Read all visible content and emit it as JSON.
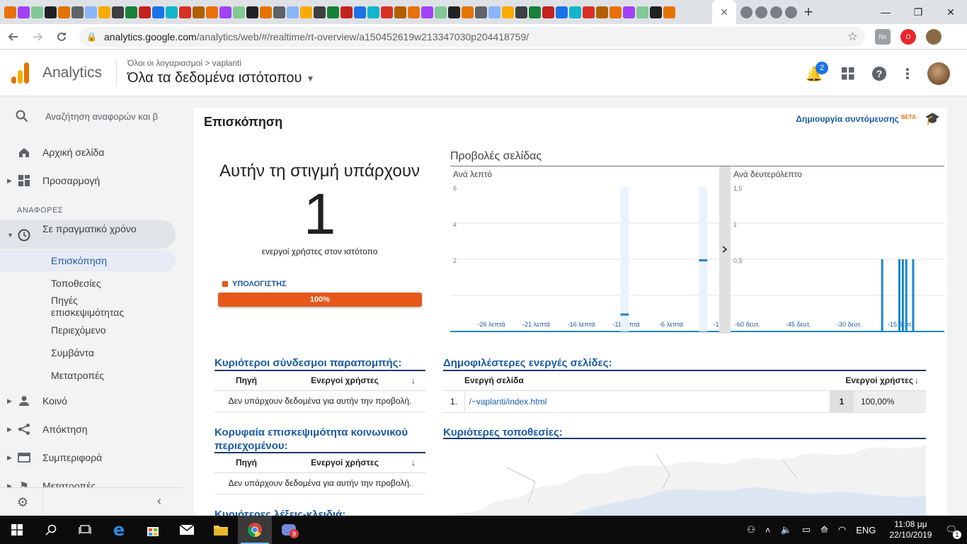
{
  "browser": {
    "url_host": "analytics.google.com",
    "url_path": "/analytics/web/#/realtime/rt-overview/a150452619w213347030p204418759/",
    "tab_close": "✕",
    "new_tab": "+",
    "win_minimize": "—",
    "win_maximize": "❐",
    "win_close": "✕",
    "ext_nx": "Nx"
  },
  "header": {
    "product": "Analytics",
    "breadcrumb": "Όλοι οι λογαριασμοί > vaplanti",
    "view": "Όλα τα δεδομένα ιστότοπου",
    "notifications": "2"
  },
  "sidebar": {
    "search_placeholder": "Αναζήτηση αναφορών και β",
    "home": "Αρχική σελίδα",
    "customization": "Προσαρμογή",
    "reports_header": "ΑΝΑΦΟΡΕΣ",
    "realtime": "Σε πραγματικό χρόνο",
    "realtime_items": [
      "Επισκόπηση",
      "Τοποθεσίες",
      "Πηγές επισκεψιμότητας",
      "Περιεχόμενο",
      "Συμβάντα",
      "Μετατροπές"
    ],
    "audience": "Κοινό",
    "acquisition": "Απόκτηση",
    "behavior": "Συμπεριφορά",
    "conversions_partial": "Μετατροπές"
  },
  "main": {
    "title": "Επισκόπηση",
    "shortcut": "Δημιουργία συντόμευσης",
    "beta": "BETA",
    "now_heading": "Αυτήν τη στιγμή υπάρχουν",
    "active_users": "1",
    "active_users_sub": "ενεργοί χρήστες στον ιστότοπο",
    "device_label": "ΥΠΟΛΟΓΙΣΤΗΣ",
    "device_percent": "100%",
    "device_share": 1.0,
    "pageviews_title": "Προβολές σελίδας",
    "per_minute": "Ανά λεπτό",
    "per_second": "Ανά δευτερόλεπτο",
    "referrals_title": "Κυριότεροι σύνδεσμοι παραπομπής:",
    "social_title": "Κορυφαία επισκεψιμότητα κοινωνικού περιεχομένου:",
    "keywords_title": "Κυριότερες λέξεις-κλειδιά:",
    "col_source": "Πηγή",
    "col_active_users": "Ενεργοί χρήστες",
    "no_data": "Δεν υπάρχουν δεδομένα για αυτήν την προβολή.",
    "pages_title": "Δημοφιλέστερες ενεργές σελίδες:",
    "col_active_page": "Ενεργή σελίδα",
    "pages_rows": [
      {
        "rank": "1.",
        "page": "/~vaplanti/index.html",
        "users": "1",
        "percent": "100,00%"
      }
    ],
    "locations_title": "Κυριότερες τοποθεσίες:"
  },
  "chart_data": [
    {
      "type": "bar",
      "title": "Ανά λεπτό",
      "x_tick_labels": [
        "-26 λεπτά",
        "-21 λεπτά",
        "-16 λεπτά",
        "-11 λεπτά",
        "-6 λεπτά",
        "-1"
      ],
      "y_tick_labels": [
        "2",
        "4",
        "6"
      ],
      "ylim": [
        0,
        8
      ],
      "x_range": [
        -30,
        0
      ],
      "bars": [
        {
          "x": -10,
          "value": 1
        },
        {
          "x": -1,
          "value": 4
        }
      ]
    },
    {
      "type": "bar",
      "title": "Ανά δευτερόλεπτο",
      "x_tick_labels": [
        "-60 δευτ.",
        "-45 δευτ.",
        "-30 δευτ.",
        "-15 δευτ."
      ],
      "y_tick_labels": [
        "0,5",
        "1",
        "1,5"
      ],
      "ylim": [
        0,
        2
      ],
      "x_range": [
        -60,
        0
      ],
      "bars": [
        {
          "x": -16,
          "value": 1
        },
        {
          "x": -11,
          "value": 1
        },
        {
          "x": -10,
          "value": 1
        },
        {
          "x": -9,
          "value": 1
        },
        {
          "x": -7,
          "value": 1
        }
      ]
    }
  ],
  "taskbar": {
    "lang": "ENG",
    "time": "11:08 μμ",
    "date": "22/10/2019",
    "notif_count": "1",
    "app_badge": "9"
  }
}
